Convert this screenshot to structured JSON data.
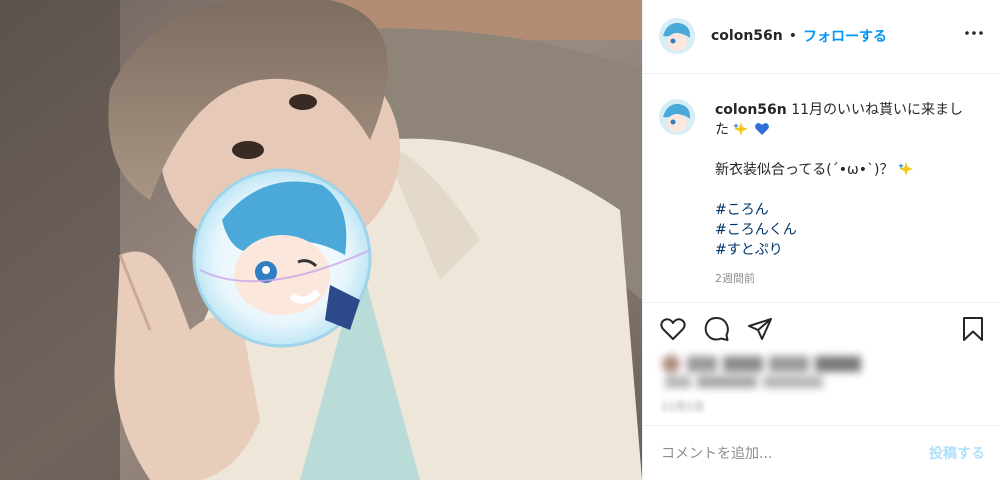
{
  "post": {
    "username": "colon56n",
    "header_separator": "•",
    "follow_label": "フォローする",
    "caption_line1": "11月のいいね貰いに来まし",
    "caption_line2": "た",
    "caption_line3": "新衣装似合ってる(´•ω•`)？",
    "hashtags": [
      "#ころん",
      "#ころんくん",
      "#すとぷり"
    ],
    "time_ago": "2週間前",
    "blurred_date": "11月1日"
  },
  "comment": {
    "placeholder": "コメントを追加...",
    "post_label": "投稿する"
  },
  "icons": {
    "more": "more-options-icon",
    "like": "heart-icon",
    "comment": "comment-icon",
    "share": "share-icon",
    "save": "bookmark-icon",
    "emoji_sparkle": "sparkle-emoji-icon",
    "emoji_heart": "blue-heart-emoji-icon"
  },
  "colors": {
    "follow": "#0095f6",
    "hashtag": "#00376b",
    "post_disabled": "#b2dffc",
    "muted": "#8e8e8e"
  }
}
